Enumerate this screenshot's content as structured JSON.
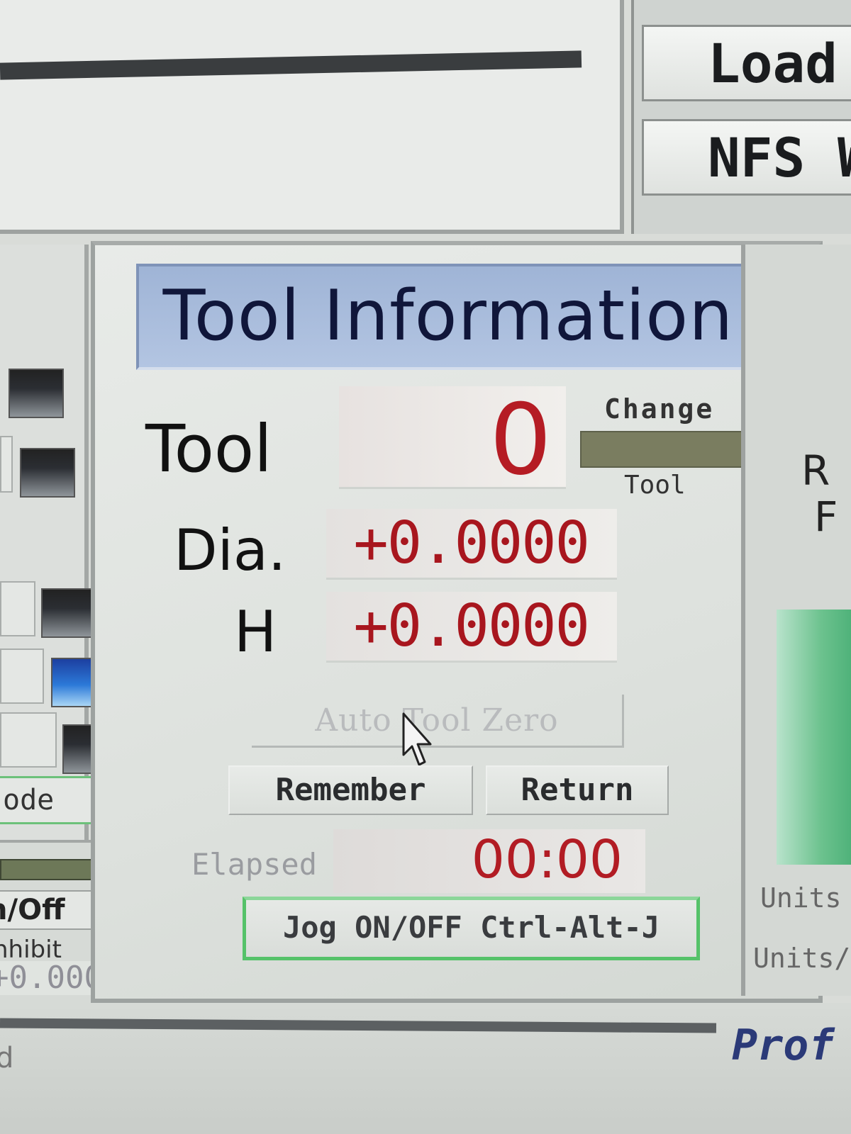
{
  "top_buttons": {
    "load_label": "Load W",
    "nfs_label": "NFS W"
  },
  "left_panel": {
    "mode_label": "ode",
    "onoff_label": "n/Off",
    "inhibit_label": "nhibit",
    "dro_value": "+0.000"
  },
  "tool_info": {
    "title": "Tool Information",
    "tool_label": "Tool",
    "tool_number": "0",
    "change_label": "Change",
    "change_sub_label": "Tool",
    "dia_label": "Dia.",
    "dia_value": "+0.0000",
    "h_label": "H",
    "h_value": "+0.0000",
    "auto_tool_zero_label": "Auto Tool Zero",
    "remember_label": "Remember",
    "return_label": "Return",
    "elapsed_label": "Elapsed",
    "elapsed_value": "00:00",
    "jog_label": "Jog ON/OFF Ctrl-Alt-J"
  },
  "right_panel": {
    "r_label": "R",
    "f_label": "F",
    "units_1": "Units",
    "units_2": "Units/"
  },
  "bottom": {
    "left_text": "d",
    "prof_text": "Prof"
  },
  "colors": {
    "dro_red": "#b51c24",
    "title_blue": "#a9bcdc",
    "jog_green": "#55c269",
    "change_led": "#7a7d60"
  },
  "icons": {
    "cursor": "arrow-cursor-icon"
  }
}
